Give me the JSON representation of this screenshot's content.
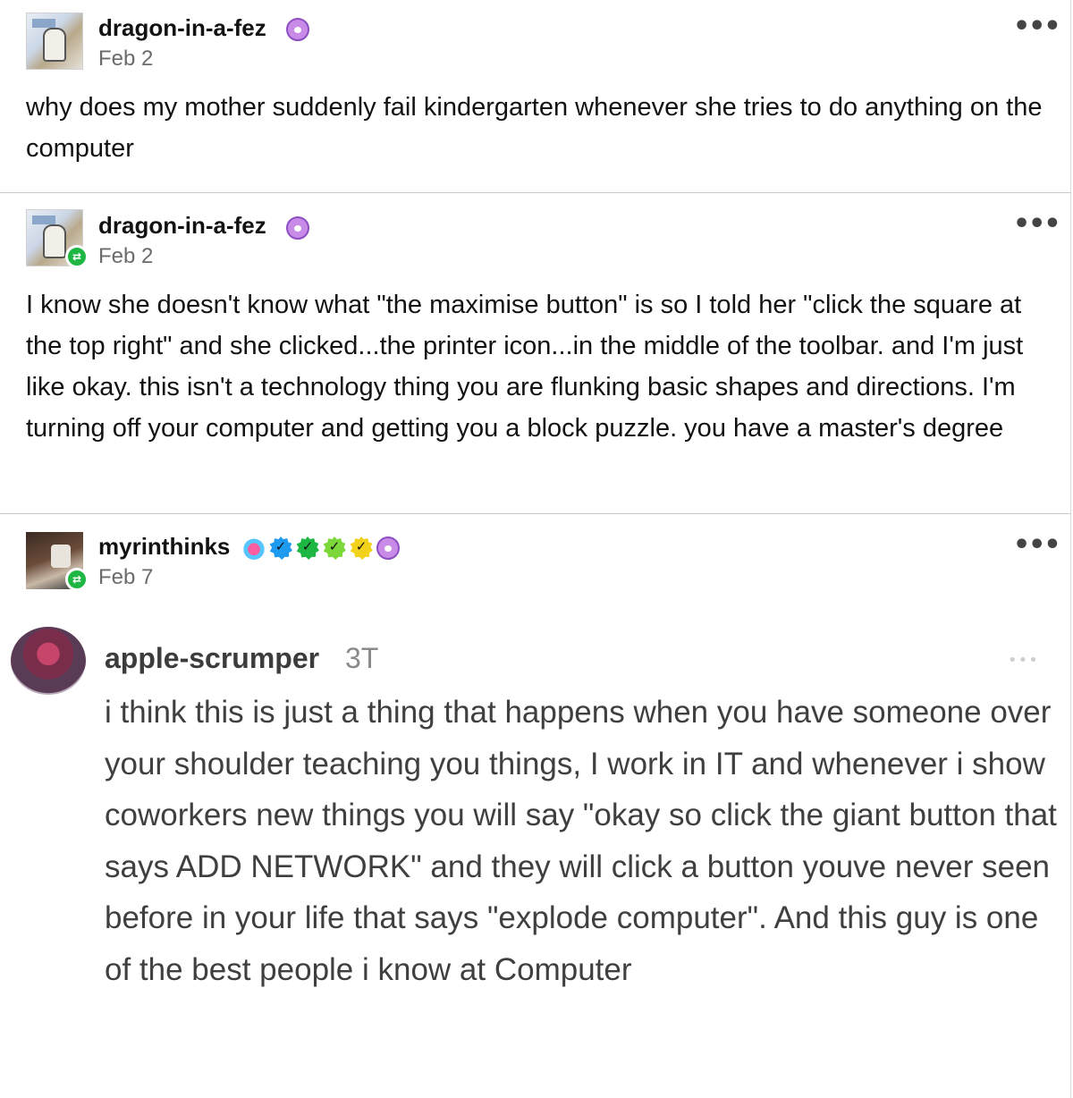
{
  "posts": [
    {
      "username": "dragon-in-a-fez",
      "date": "Feb 2",
      "body": "why does my mother suddenly fail kindergarten whenever she tries to do anything on the computer",
      "menu": "•••"
    },
    {
      "username": "dragon-in-a-fez",
      "date": "Feb 2",
      "reblog_icon": "⇄",
      "body": "I know she doesn't know what \"the maximise button\" is so I told her \"click the square at the top right\" and she clicked...the printer icon...in the middle of the toolbar. and I'm just like okay. this isn't a technology thing you are flunking basic shapes and directions. I'm turning off your computer and getting you a block puzzle. you have a master's degree",
      "menu": "•••"
    },
    {
      "username": "myrinthinks",
      "date": "Feb 7",
      "reblog_icon": "⇄",
      "menu": "•••",
      "embedded_comment": {
        "username": "apple-scrumper",
        "time": "3T",
        "menu": "•••",
        "text": "i think this is just a thing that happens when you have someone over your shoulder teaching you things, I work in IT and whenever i show coworkers new things you will say \"okay so click the giant button that says ADD NETWORK\" and they will click a button youve never seen before in your life that says \"explode computer\". And this guy is one of the best people i know at Computer"
      }
    }
  ],
  "badge_icons": [
    "paw-icon",
    "crab-icon",
    "blue-check-icon",
    "green-check-icon",
    "lime-check-icon",
    "yellow-check-icon"
  ],
  "colors": {
    "reblog_green": "#1fb743",
    "paw_purple": "#c98be8",
    "check_blue": "#1e9bf0",
    "check_green": "#1fb743",
    "check_lime": "#7cd83a",
    "check_yellow": "#f2d21b"
  }
}
